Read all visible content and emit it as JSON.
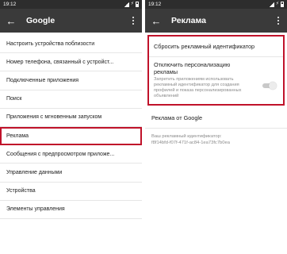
{
  "left": {
    "status_time": "19:12",
    "title": "Google",
    "items": [
      "Настроить устройства поблизости",
      "Номер телефона, связанный с устройст...",
      "Подключенные приложения",
      "Поиск",
      "Приложения с мгновенным запуском",
      "Реклама",
      "Сообщения с предпросмотром приложе...",
      "Управление данными",
      "Устройства",
      "Элементы управления"
    ]
  },
  "right": {
    "status_time": "19:12",
    "title": "Реклама",
    "reset_label": "Сбросить рекламный идентификатор",
    "personalize_title": "Отключить персонализацию рекламы",
    "personalize_desc": "Запретить приложениям использовать рекламный идентификатор для создания профилей и показа персонализированных объявлений",
    "personalize_enabled": false,
    "ads_by_google": "Реклама от Google",
    "ad_id_label": "Ваш рекламный идентификатор:",
    "ad_id_value": "f8f14bfd-f07f-471f-ac84-1ea73fc7b0ea"
  },
  "colors": {
    "highlight": "#c0122a",
    "appbar": "#3a3a3a",
    "statusbar": "#2d2d2d"
  }
}
